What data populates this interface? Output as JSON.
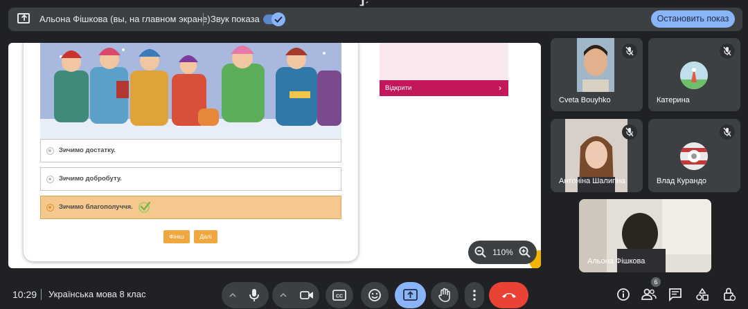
{
  "presenting_bar": {
    "presenter_text": "Альона Фішкова (вы, на главном экране)",
    "audio_label": "Звук показа",
    "audio_enabled": true,
    "stop_button": "Остановить показ"
  },
  "shared_screen": {
    "options": [
      {
        "text": "Зичимо достатку.",
        "selected": false
      },
      {
        "text": "Зичимо добробуту.",
        "selected": false
      },
      {
        "text": "Зичимо благополуччя.",
        "selected": true
      }
    ],
    "finish_button": "Фініш",
    "next_button": "Далі",
    "open_button": "Відкрити",
    "zoom_level": "110%"
  },
  "participants": [
    {
      "name": "Cveta Bouyhko",
      "muted": true,
      "video": true
    },
    {
      "name": "Катерина",
      "muted": true,
      "video": false
    },
    {
      "name": "Антоніна Шалигіна",
      "muted": true,
      "video": true
    },
    {
      "name": "Влад Курандо",
      "muted": true,
      "video": false
    },
    {
      "name": "Альона Фішкова",
      "muted": false,
      "video": true
    }
  ],
  "bottom_bar": {
    "time": "10:29",
    "meeting_title": "Українська мова 8 клас",
    "participant_count": "6"
  },
  "colors": {
    "accent": "#8ab4f8",
    "end_call": "#ea4335",
    "selected_option": "#f5c88e",
    "open_button": "#c2185b"
  }
}
